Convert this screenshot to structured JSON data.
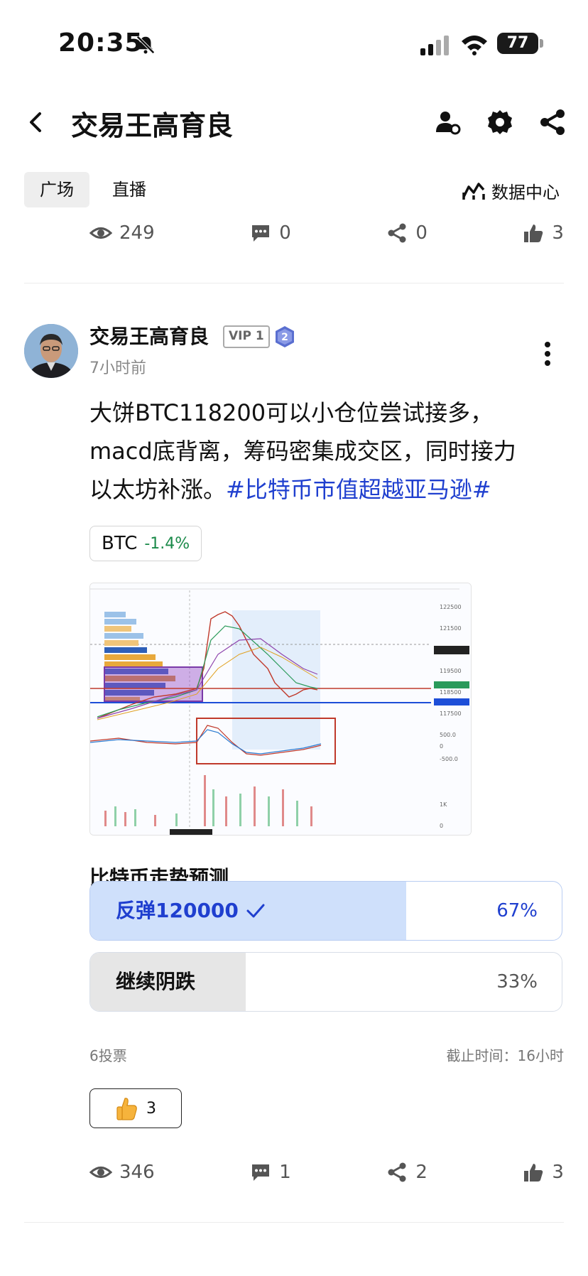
{
  "status_bar": {
    "time": "20:35",
    "battery": "77"
  },
  "nav": {
    "title": "交易王高育良"
  },
  "tabs": [
    {
      "label": "广场"
    },
    {
      "label": "直播"
    }
  ],
  "data_center": {
    "label": "数据中心"
  },
  "prev_post_stats": {
    "views": "249",
    "comments": "0",
    "shares": "0",
    "likes": "3"
  },
  "post": {
    "author": "交易王高育良",
    "vip": "VIP 1",
    "level": "2",
    "time": "7小时前",
    "text_lines": [
      "大饼BTC118200可以小仓位尝试接多，",
      "macd底背离，筹码密集成交区，同时接力",
      "以太坊补涨。"
    ],
    "hashtag": "#比特币市值超越亚马逊#",
    "coin": {
      "symbol": "BTC",
      "change": "-1.4%"
    },
    "chart_image": {
      "description_kind": "candlestick-chart",
      "price_ticks": [
        "122500",
        "121500",
        "120500",
        "119500",
        "118500",
        "117500"
      ],
      "macd_ticks": [
        "500.0",
        "0",
        "-500.0"
      ],
      "volume_ticks": [
        "1K",
        "0"
      ]
    },
    "poll": {
      "title": "比特币走势预测",
      "options": [
        {
          "label": "反弹120000",
          "percent": "67%",
          "fill": 0.67,
          "selected": true
        },
        {
          "label": "继续阴跌",
          "percent": "33%",
          "fill": 0.33,
          "selected": false
        }
      ],
      "votes": "6投票",
      "deadline": "截止时间：16小时"
    },
    "reaction": {
      "count": "3"
    },
    "stats": {
      "views": "346",
      "comments": "1",
      "shares": "2",
      "likes": "3"
    }
  },
  "colors": {
    "accent": "#1f3fcf",
    "selected_fill": "#cfe0fb",
    "unselected_fill": "#e6e6e6",
    "positive": "#1b8a4a"
  }
}
